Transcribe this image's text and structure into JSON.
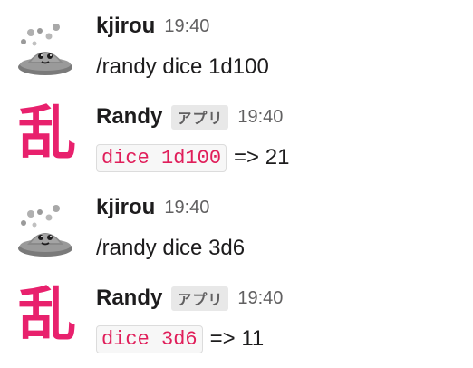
{
  "messages": [
    {
      "user": "kjirou",
      "time": "19:40",
      "avatar_icon": "flying-saucer-icon",
      "text": "/randy dice 1d100"
    },
    {
      "user": "Randy",
      "badge": "アプリ",
      "time": "19:40",
      "avatar_glyph": "乱",
      "code": "dice 1d100",
      "result": "=> 21"
    },
    {
      "user": "kjirou",
      "time": "19:40",
      "avatar_icon": "flying-saucer-icon",
      "text": "/randy dice 3d6"
    },
    {
      "user": "Randy",
      "badge": "アプリ",
      "time": "19:40",
      "avatar_glyph": "乱",
      "code": "dice 3d6",
      "result": "=> 11"
    }
  ],
  "colors": {
    "kanji_avatar": "#e8216d",
    "code_text": "#e01e5a",
    "timestamp": "#616061",
    "badge_bg": "#e8e8e8"
  }
}
